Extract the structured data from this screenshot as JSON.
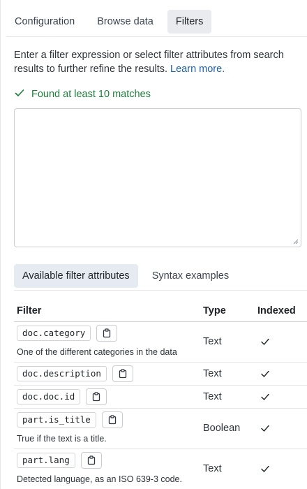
{
  "tabs": [
    {
      "label": "Configuration",
      "active": false
    },
    {
      "label": "Browse data",
      "active": false
    },
    {
      "label": "Filters",
      "active": true
    }
  ],
  "description": {
    "text": "Enter a filter expression or select filter attributes from search results to further refine the results. ",
    "link": "Learn more."
  },
  "status": {
    "text": "Found at least 10 matches",
    "color": "#1a7f37"
  },
  "filter_input": {
    "value": "",
    "placeholder": ""
  },
  "subtabs": [
    {
      "label": "Available filter attributes",
      "active": true
    },
    {
      "label": "Syntax examples",
      "active": false
    }
  ],
  "table": {
    "headers": {
      "filter": "Filter",
      "type": "Type",
      "indexed": "Indexed"
    },
    "rows": [
      {
        "name": "doc.category",
        "description": "One of the different categories in the data",
        "type": "Text",
        "indexed": true
      },
      {
        "name": "doc.description",
        "description": "",
        "type": "Text",
        "indexed": true
      },
      {
        "name": "doc.doc.id",
        "description": "",
        "type": "Text",
        "indexed": true
      },
      {
        "name": "part.is_title",
        "description": "True if the text is a title.",
        "type": "Boolean",
        "indexed": true
      },
      {
        "name": "part.lang",
        "description": "Detected language, as an ISO 639-3 code.",
        "type": "Text",
        "indexed": true
      }
    ]
  },
  "icons": {
    "status": "check-icon",
    "copy": "clipboard-icon",
    "indexed": "check-icon"
  }
}
